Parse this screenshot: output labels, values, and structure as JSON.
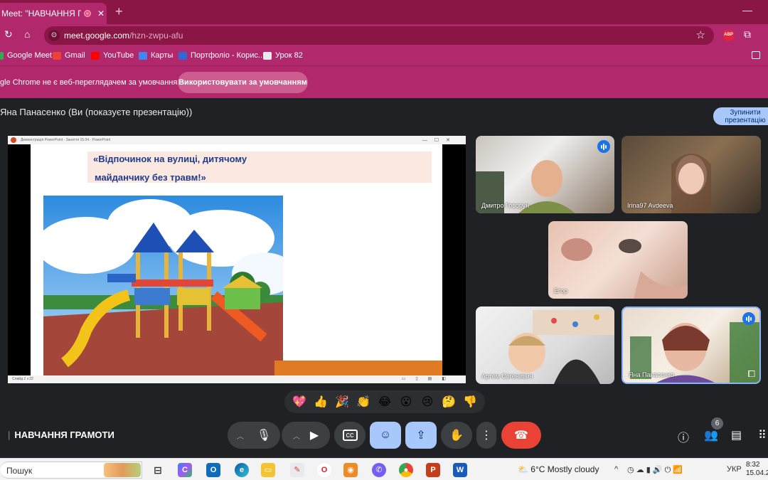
{
  "browser": {
    "tab_title": "Meet: \"НАВЧАННЯ ГРАМО",
    "tab_close": "✕",
    "new_tab": "+",
    "url_domain": "meet.google.com",
    "url_path": "/hzn-zwpu-afu",
    "bookmarks": [
      {
        "label": "Google Meet",
        "color": "#34a853"
      },
      {
        "label": "Gmail",
        "color": "#ea4335"
      },
      {
        "label": "YouTube",
        "color": "#ff0000"
      },
      {
        "label": "Карты",
        "color": "#4285f4"
      },
      {
        "label": "Портфоліо - Корис...",
        "color": "#3367d6"
      },
      {
        "label": "Урок 82",
        "color": "#e8eaed"
      }
    ],
    "infobar_message": "gle Chrome не є веб-переглядачем за умовчанням",
    "infobar_button": "Використовувати за умовчанням",
    "abp_label": "ABP"
  },
  "meet": {
    "presenting_text": "Яна Панасенко (Ви (показуєте презентацію))",
    "stop_button_line1": "Зупинити",
    "stop_button_line2": "презентацію",
    "slide": {
      "window_title": "Демонстрація PowerPoint - Заняття 15.04 - PowerPoint",
      "title_line1": "«Відпочинок на вулиці, дитячому",
      "title_line2": "майданчику без травм!»",
      "status": "Слайд 2 з 22"
    },
    "participants": [
      {
        "name": "Дмитро Говорун",
        "speaking": true
      },
      {
        "name": "Irina97 Avdeeva",
        "speaking": false
      },
      {
        "name": "Егор",
        "speaking": false
      },
      {
        "name": "Артем Євгенивич",
        "speaking": false
      },
      {
        "name": "Яна Панасенко",
        "speaking": true
      }
    ],
    "reactions": [
      "💖",
      "👍",
      "🎉",
      "👏",
      "😂",
      "😮",
      "😢",
      "🤔",
      "👎"
    ],
    "meeting_name": "НАВЧАННЯ ГРАМОТИ",
    "participant_count": "6"
  },
  "taskbar": {
    "search_label": "Пошук",
    "weather": "6°C  Mostly cloudy",
    "language": "УКР",
    "time": "8:32",
    "date": "15.04.20"
  },
  "colors": {
    "chrome_frame": "#b1286c",
    "chrome_tabstrip": "#8a1646",
    "meet_bg": "#202124",
    "end_call": "#ea4335",
    "active_control": "#a8c7fa"
  }
}
